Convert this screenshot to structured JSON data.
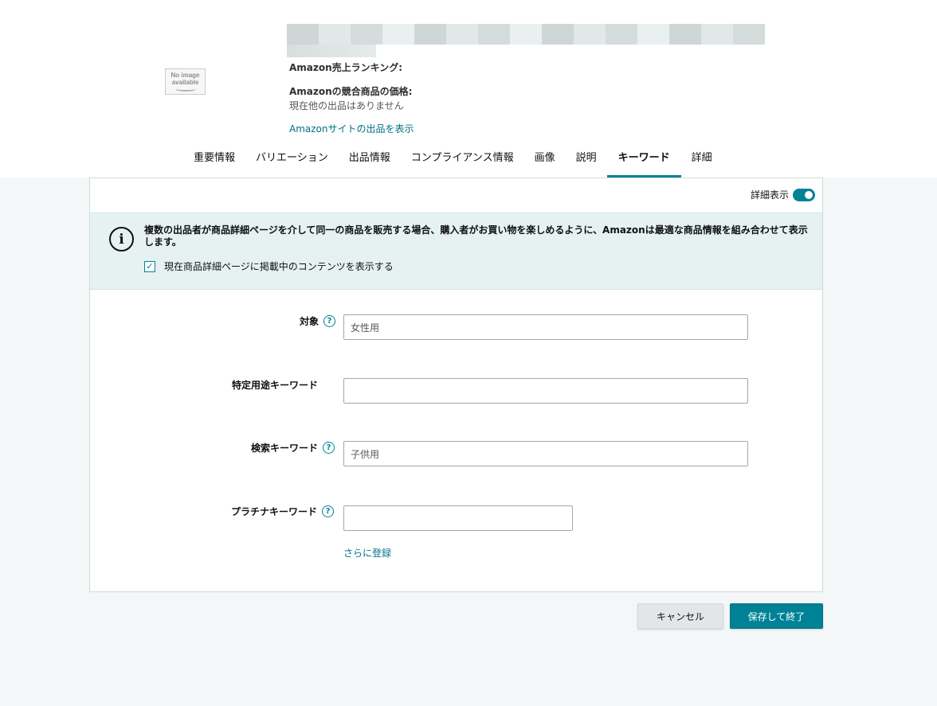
{
  "product": {
    "ranking_label": "Amazon売上ランキング:",
    "competitor_price_label": "Amazonの競合商品の価格:",
    "competitor_price_value": "現在他の出品はありません",
    "view_listing_link": "Amazonサイトの出品を表示",
    "no_image_line1": "No image",
    "no_image_line2": "available"
  },
  "tabs": [
    {
      "label": "重要情報"
    },
    {
      "label": "バリエーション"
    },
    {
      "label": "出品情報"
    },
    {
      "label": "コンプライアンス情報"
    },
    {
      "label": "画像"
    },
    {
      "label": "説明"
    },
    {
      "label": "キーワード"
    },
    {
      "label": "詳細"
    }
  ],
  "active_tab": "キーワード",
  "detail_toggle": {
    "label": "詳細表示",
    "on": true
  },
  "alert": {
    "text": "複数の出品者が商品詳細ページを介して同一の商品を販売する場合、購入者がお買い物を楽しめるように、Amazonは最適な商品情報を組み合わせて表示します。",
    "checkbox_label": "現在商品詳細ページに掲載中のコンテンツを表示する",
    "checkbox_checked": true
  },
  "fields": {
    "target": {
      "label": "対象",
      "value": "女性用"
    },
    "special_keyword": {
      "label": "特定用途キーワード",
      "value": ""
    },
    "search_keyword": {
      "label": "検索キーワード",
      "value": "子供用"
    },
    "platinum_keyword": {
      "label": "プラチナキーワード",
      "value": ""
    }
  },
  "add_more_link": "さらに登録",
  "buttons": {
    "cancel": "キャンセル",
    "save": "保存して終了"
  },
  "colors": {
    "accent": "#008296",
    "link": "#007185",
    "alert_bg": "#e6f1f2",
    "page_bg": "#f4f7f7"
  }
}
